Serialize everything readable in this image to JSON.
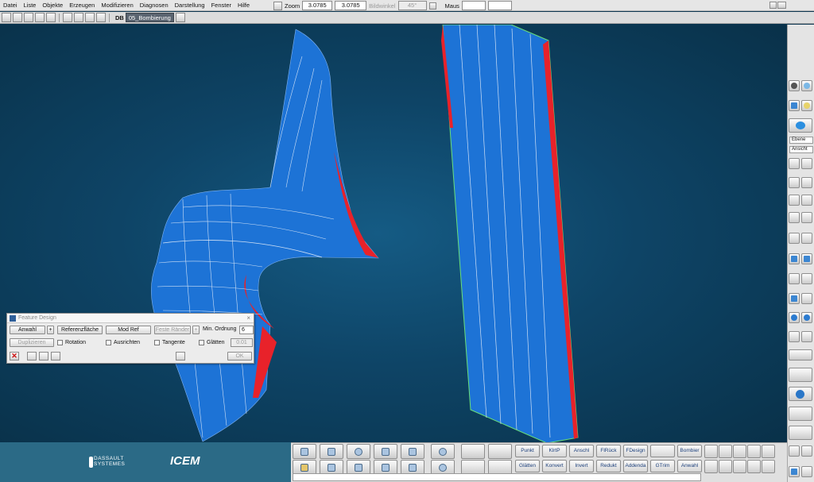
{
  "menubar": {
    "items": [
      "Datei",
      "Liste",
      "Objekte",
      "Erzeugen",
      "Modifizieren",
      "Diagnosen",
      "Darstellung",
      "Fenster",
      "Hilfe"
    ],
    "zoom_label": "Zoom",
    "zoom_value_1": "3.0785",
    "zoom_value_2": "3.0785",
    "bildwinkel_label": "Bildwinkel",
    "bildwinkel_value": "45°",
    "maus_label": "Maus"
  },
  "toolbar": {
    "db_label": "DB",
    "db_value": "05_Bombierung"
  },
  "right_panel": {
    "select_1": "Ebene",
    "select_2": "Ansicht"
  },
  "dialog": {
    "title": "Feature Design",
    "close": "×",
    "anwahl": "Anwahl",
    "plus1": "+",
    "referenzflaeche": "Referenzfläche",
    "mod_ref": "Mod Ref",
    "feste_raender": "Feste Ränder",
    "plus2": "+",
    "min_ordnung_label": "Min. Ordnung",
    "min_ordnung_value": "6",
    "duplizieren": "Duplizieren",
    "rotation": "Rotation",
    "ausrichten": "Ausrichten",
    "tangente": "Tangente",
    "glaetten": "Glätten",
    "glaetten_value": "0.01",
    "ok": "OK"
  },
  "bottom": {
    "brand_ds_line1": "DASSAULT",
    "brand_ds_line2": "SYSTEMES",
    "brand_ice": "ICEM",
    "row1": [
      "Punkt",
      "KlrtP",
      "Anschl",
      "FlRück",
      "FDesign",
      "",
      "Bombier"
    ],
    "row2": [
      "Glätten",
      "Konvert",
      "Invert",
      "Redukt",
      "Addenda",
      "GTrim",
      "Anwahl"
    ]
  },
  "colors": {
    "surface_blue": "#1d73d6",
    "surface_red": "#e8222a",
    "viewport_bg": "#0e4466",
    "brand_bg": "#2b6a86"
  }
}
